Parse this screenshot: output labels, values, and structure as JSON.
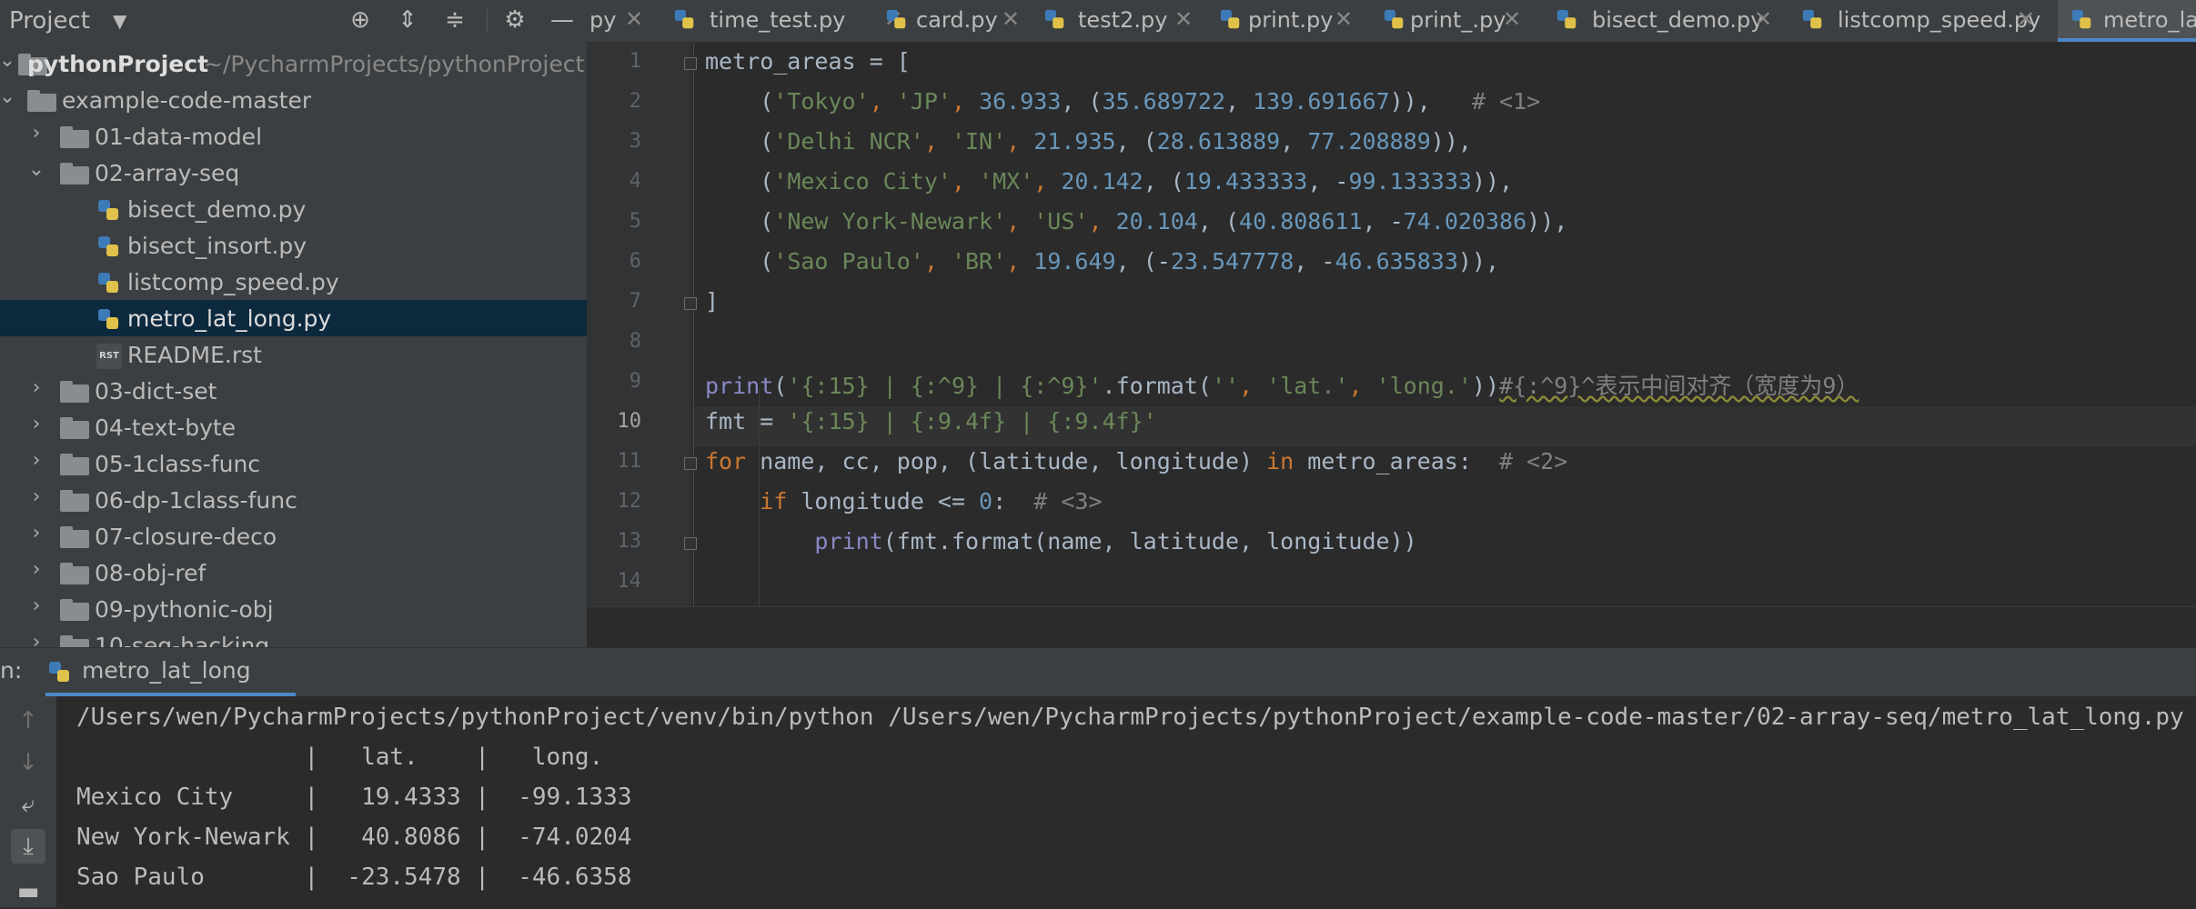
{
  "project_panel": {
    "title": "Project",
    "tree": [
      {
        "label": "pythonProject",
        "path": "~/PycharmProjects/pythonProject",
        "kind": "root"
      },
      {
        "label": "example-code-master",
        "kind": "folder"
      },
      {
        "label": "01-data-model",
        "kind": "folder"
      },
      {
        "label": "02-array-seq",
        "kind": "folder"
      },
      {
        "label": "bisect_demo.py",
        "kind": "py"
      },
      {
        "label": "bisect_insort.py",
        "kind": "py"
      },
      {
        "label": "listcomp_speed.py",
        "kind": "py"
      },
      {
        "label": "metro_lat_long.py",
        "kind": "py",
        "selected": true
      },
      {
        "label": "README.rst",
        "kind": "rst"
      },
      {
        "label": "03-dict-set",
        "kind": "folder"
      },
      {
        "label": "04-text-byte",
        "kind": "folder"
      },
      {
        "label": "05-1class-func",
        "kind": "folder"
      },
      {
        "label": "06-dp-1class-func",
        "kind": "folder"
      },
      {
        "label": "07-closure-deco",
        "kind": "folder"
      },
      {
        "label": "08-obj-ref",
        "kind": "folder"
      },
      {
        "label": "09-pythonic-obj",
        "kind": "folder"
      },
      {
        "label": "10-seq-hacking",
        "kind": "folder"
      }
    ]
  },
  "tabs": [
    {
      "label": "py"
    },
    {
      "label": "time_test.py"
    },
    {
      "label": "card.py"
    },
    {
      "label": "test2.py"
    },
    {
      "label": "print.py"
    },
    {
      "label": "print_.py"
    },
    {
      "label": "bisect_demo.py"
    },
    {
      "label": "listcomp_speed.py"
    },
    {
      "label": "metro_lat",
      "active": true
    }
  ],
  "editor": {
    "line_numbers": [
      "1",
      "2",
      "3",
      "4",
      "5",
      "6",
      "7",
      "8",
      "9",
      "10",
      "11",
      "12",
      "13",
      "14"
    ],
    "current_line": "10",
    "code": {
      "l1": {
        "a": "metro_areas = ["
      },
      "l2": {
        "a": "    (",
        "s1": "'Tokyo'",
        "c1": ", ",
        "s2": "'JP'",
        "c2": ", ",
        "n1": "36.933",
        "c3": ", (",
        "n2": "35.689722",
        "c4": ", ",
        "n3": "139.691667",
        "c5": ")),   ",
        "cm": "# <1>"
      },
      "l3": {
        "a": "    (",
        "s1": "'Delhi NCR'",
        "c1": ", ",
        "s2": "'IN'",
        "c2": ", ",
        "n1": "21.935",
        "c3": ", (",
        "n2": "28.613889",
        "c4": ", ",
        "n3": "77.208889",
        "c5": ")),"
      },
      "l4": {
        "a": "    (",
        "s1": "'Mexico City'",
        "c1": ", ",
        "s2": "'MX'",
        "c2": ", ",
        "n1": "20.142",
        "c3": ", (",
        "n2": "19.433333",
        "c4": ", -",
        "n3": "99.133333",
        "c5": ")),"
      },
      "l5": {
        "a": "    (",
        "s1": "'New York-Newark'",
        "c1": ", ",
        "s2": "'US'",
        "c2": ", ",
        "n1": "20.104",
        "c3": ", (",
        "n2": "40.808611",
        "c4": ", -",
        "n3": "74.020386",
        "c5": ")),"
      },
      "l6": {
        "a": "    (",
        "s1": "'Sao Paulo'",
        "c1": ", ",
        "s2": "'BR'",
        "c2": ", ",
        "n1": "19.649",
        "c3": ", (-",
        "n2": "23.547778",
        "c4": ", -",
        "n3": "46.635833",
        "c5": ")),"
      },
      "l7": {
        "a": "]"
      },
      "l9": {
        "fn": "print",
        "p1": "(",
        "s1": "'{:15} | {:^9} | {:^9}'",
        "p2": ".format(",
        "s2": "''",
        "c1": ", ",
        "s3": "'lat.'",
        "c2": ", ",
        "s4": "'long.'",
        "p3": "))",
        "cm": "#{:^9}^表示中间对齐（宽度为9）"
      },
      "l10": {
        "a": "fmt = ",
        "s1": "'{:15} | {:9.4f} | {:9.4f}'"
      },
      "l11": {
        "kw1": "for",
        "a": " name, cc, pop, (latitude, longitude) ",
        "kw2": "in",
        "b": " metro_areas:  ",
        "cm": "# <2>"
      },
      "l12": {
        "i": "    ",
        "kw": "if",
        "a": " longitude <= ",
        "n": "0",
        "b": ":  ",
        "cm": "# <3>"
      },
      "l13": {
        "i": "        ",
        "fn": "print",
        "a": "(fmt.format(name, latitude, longitude))"
      }
    }
  },
  "run_panel": {
    "prefix": "n:",
    "tab_label": "metro_lat_long",
    "output": [
      "/Users/wen/PycharmProjects/pythonProject/venv/bin/python /Users/wen/PycharmProjects/pythonProject/example-code-master/02-array-seq/metro_lat_long.py",
      "                |   lat.    |   long.  ",
      "Mexico City     |   19.4333 |  -99.1333",
      "New York-Newark |   40.8086 |  -74.0204",
      "Sao Paulo       |  -23.5478 |  -46.6358"
    ]
  },
  "colors": {
    "selection": "#0d293e",
    "accent": "#4a88c7",
    "string": "#6a8759",
    "number": "#6897bb",
    "keyword": "#cc7832"
  }
}
